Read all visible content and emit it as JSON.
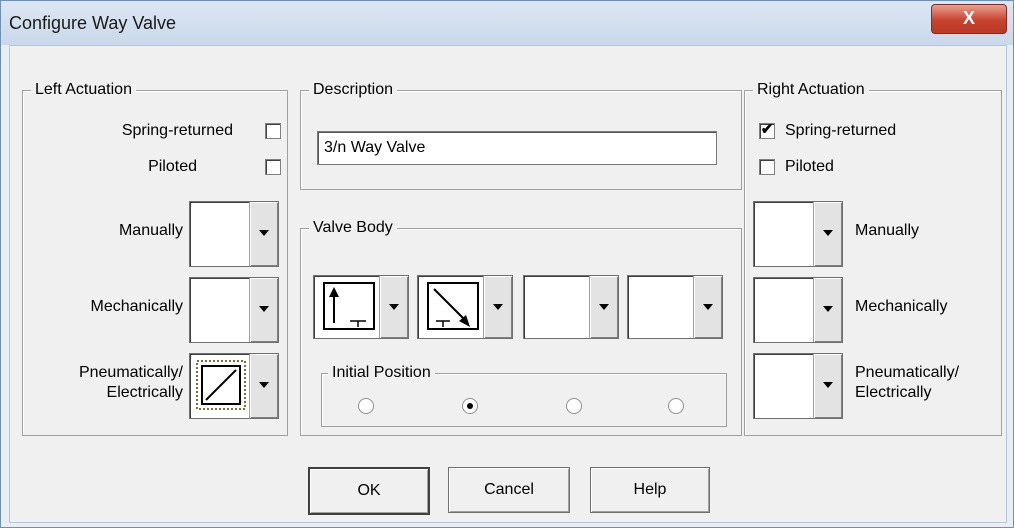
{
  "window": {
    "title": "Configure Way Valve",
    "close_label": "X"
  },
  "left_actuation": {
    "legend": "Left Actuation",
    "spring_returned": {
      "label": "Spring-returned",
      "checked": false
    },
    "piloted": {
      "label": "Piloted",
      "checked": false
    },
    "manually": {
      "label": "Manually",
      "symbol": ""
    },
    "mechanically": {
      "label": "Mechanically",
      "symbol": ""
    },
    "pneumatic": {
      "label_line1": "Pneumatically/",
      "label_line2": "Electrically",
      "symbol": "solenoid-diagonal"
    }
  },
  "description": {
    "legend": "Description",
    "value": "3/n Way Valve"
  },
  "valve_body": {
    "legend": "Valve Body",
    "positions": [
      {
        "symbol": "arrow-up-tank"
      },
      {
        "symbol": "diagonal-arrow-tank"
      },
      {
        "symbol": ""
      },
      {
        "symbol": ""
      }
    ],
    "initial_position": {
      "legend": "Initial Position",
      "selected_index": 1,
      "count": 4
    }
  },
  "right_actuation": {
    "legend": "Right Actuation",
    "spring_returned": {
      "label": "Spring-returned",
      "checked": true
    },
    "piloted": {
      "label": "Piloted",
      "checked": false
    },
    "manually": {
      "label": "Manually",
      "symbol": ""
    },
    "mechanically": {
      "label": "Mechanically",
      "symbol": ""
    },
    "pneumatic": {
      "label_line1": "Pneumatically/",
      "label_line2": "Electrically",
      "symbol": ""
    }
  },
  "buttons": {
    "ok": "OK",
    "cancel": "Cancel",
    "help": "Help"
  },
  "colors": {
    "title_bg": "#d3e0ef",
    "close_red": "#c9422e",
    "dialog_bg": "#f0f0f0"
  }
}
